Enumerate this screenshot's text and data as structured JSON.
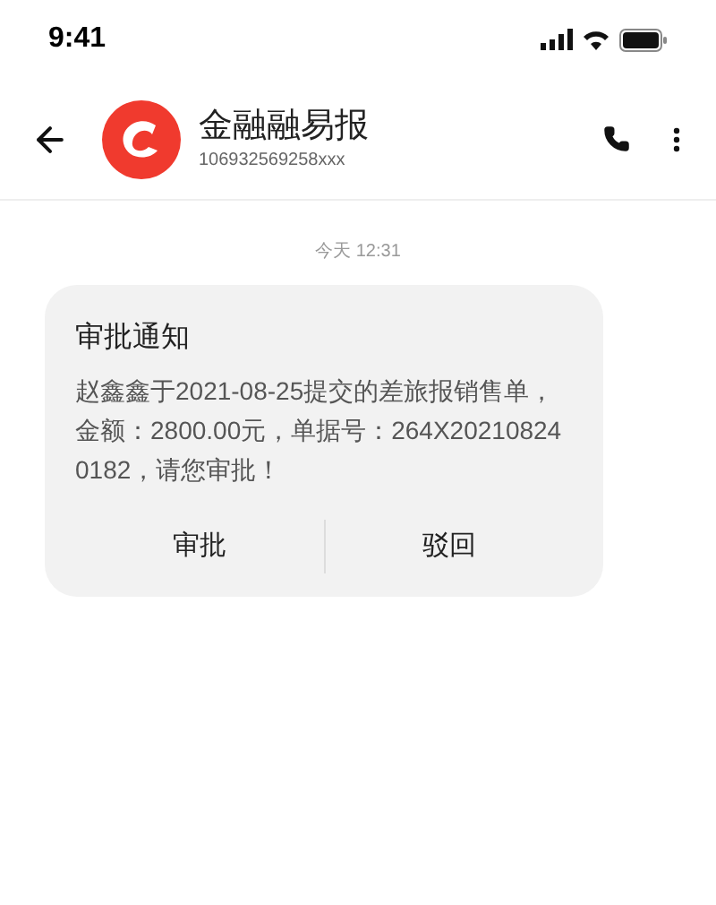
{
  "status_bar": {
    "time": "9:41"
  },
  "header": {
    "name": "金融融易报",
    "number": "106932569258xxx"
  },
  "messages": [
    {
      "timestamp": "今天 12:31",
      "title": "审批通知",
      "body": "赵鑫鑫于2021-08-25提交的差旅报销售单，金额：2800.00元，单据号：264X202108240182，请您审批！",
      "actions": [
        "审批",
        "驳回"
      ]
    }
  ]
}
